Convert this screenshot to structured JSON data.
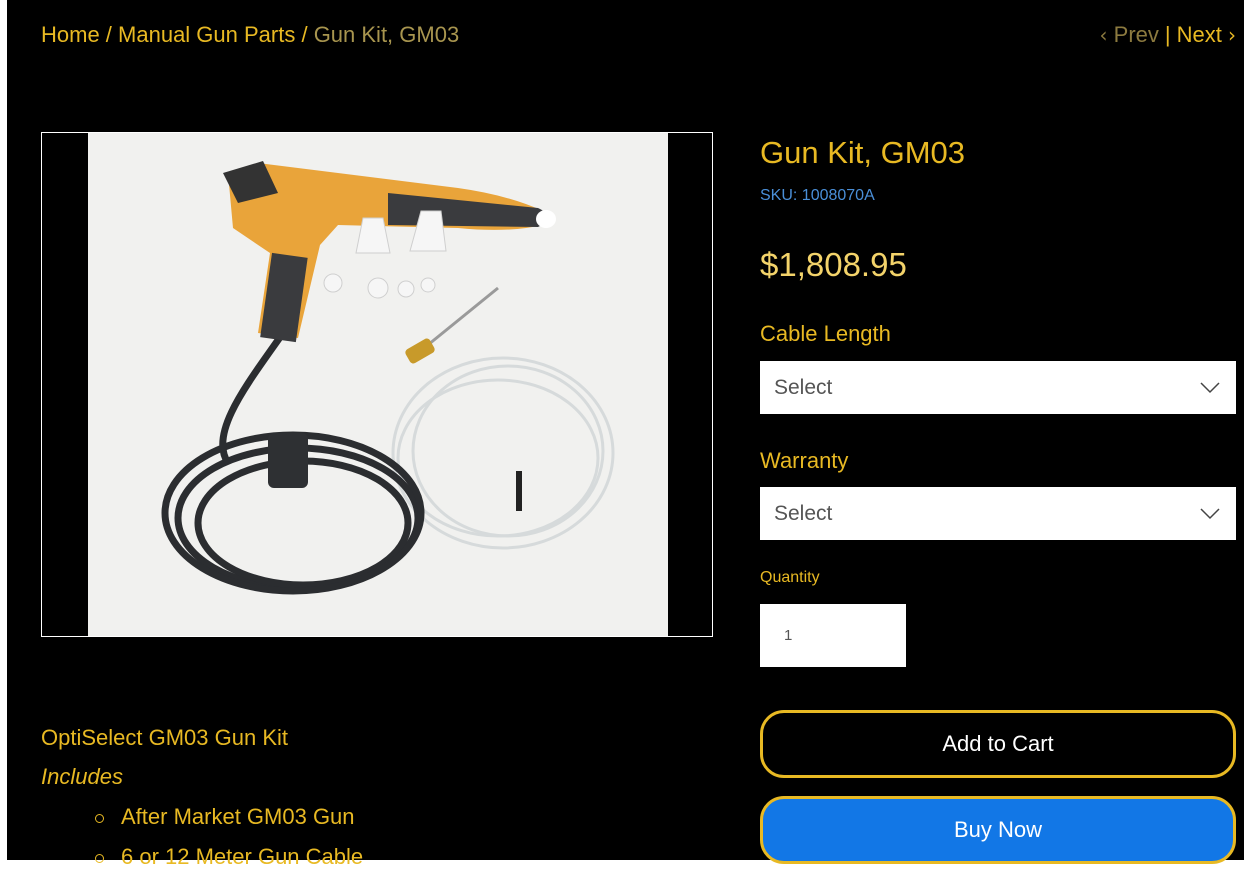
{
  "breadcrumb": {
    "home": "Home",
    "sep1": " / ",
    "category": "Manual Gun Parts",
    "sep2": " / ",
    "current": "Gun Kit, GM03"
  },
  "pager": {
    "prev": "Prev",
    "separator": "|",
    "next": "Next"
  },
  "product": {
    "name": "Gun Kit, GM03",
    "sku": "SKU: 1008070A",
    "price": "$1,808.95"
  },
  "options": {
    "cable_label": "Cable Length",
    "cable_value": "Select",
    "warranty_label": "Warranty",
    "warranty_value": "Select",
    "quantity_label": "Quantity",
    "quantity_value": "1"
  },
  "actions": {
    "add_to_cart": "Add to Cart",
    "buy_now": "Buy Now"
  },
  "description": {
    "title": "OptiSelect GM03 Gun Kit",
    "includes": "Includes",
    "items": [
      "After Market GM03 Gun",
      "6 or 12 Meter Gun Cable"
    ]
  },
  "colors": {
    "accent": "#e8b923",
    "sku": "#4a8fd8",
    "buy_button": "#1277e6",
    "background": "#000000"
  }
}
